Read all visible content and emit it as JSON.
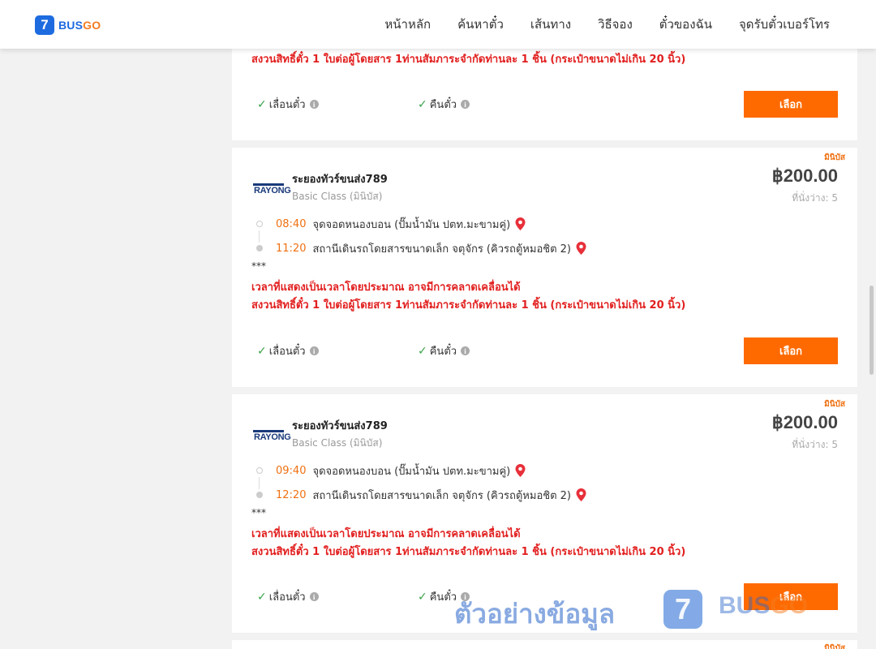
{
  "header": {
    "logo_number": "7",
    "logo_bus": "BUS",
    "logo_go": "GO",
    "nav": [
      "หน้าหลัก",
      "ค้นหาตั๋ว",
      "เส้นทาง",
      "วิธีจอง",
      "ตั๋วของฉัน",
      "จุดรับตั๋วเบอร์โทร"
    ]
  },
  "common": {
    "baggage_note": "สงวนสิทธิ์ตั๋ว 1 ใบต่อผู้โดยสาร 1ท่านสัมภาระจำกัดท่านละ 1 ชิ้น (กระเป๋าขนาดไม่เกิน 20 นิ้ว)",
    "time_note": "เวลาที่แสดงเป็นเวลาโดยประมาณ อาจมีการคลาดเคลื่อนได้",
    "stars": "***",
    "reschedule": "เลื่อนตั๋ว",
    "refund": "คืนตั๋ว",
    "select": "เลือก",
    "badge": "มินิบัส",
    "operator_logo_text": "RAYONG"
  },
  "trips": [
    {
      "operator": "ระยองทัวร์ขนส่ง789",
      "class": "Basic Class (มินิบัส)",
      "price": "฿200.00",
      "seats": "ที่นั่งว่าง: 5",
      "depart_time": "08:40",
      "depart_place": "จุดจอดหนองบอน (ปั๊มน้ำมัน ปตท.มะขามคู่)",
      "arrive_time": "11:20",
      "arrive_place": "สถานีเดินรถโดยสารขนาดเล็ก จตุจักร (คิวรถตู้หมอชิต 2)"
    },
    {
      "operator": "ระยองทัวร์ขนส่ง789",
      "class": "Basic Class (มินิบัส)",
      "price": "฿200.00",
      "seats": "ที่นั่งว่าง: 5",
      "depart_time": "09:40",
      "depart_place": "จุดจอดหนองบอน (ปั๊มน้ำมัน ปตท.มะขามคู่)",
      "arrive_time": "12:20",
      "arrive_place": "สถานีเดินรถโดยสารขนาดเล็ก จตุจักร (คิวรถตู้หมอชิต 2)"
    }
  ],
  "watermark": {
    "text": "ตัวอย่างข้อมูล",
    "number": "7",
    "bus": "BUS",
    "go": "GO"
  }
}
